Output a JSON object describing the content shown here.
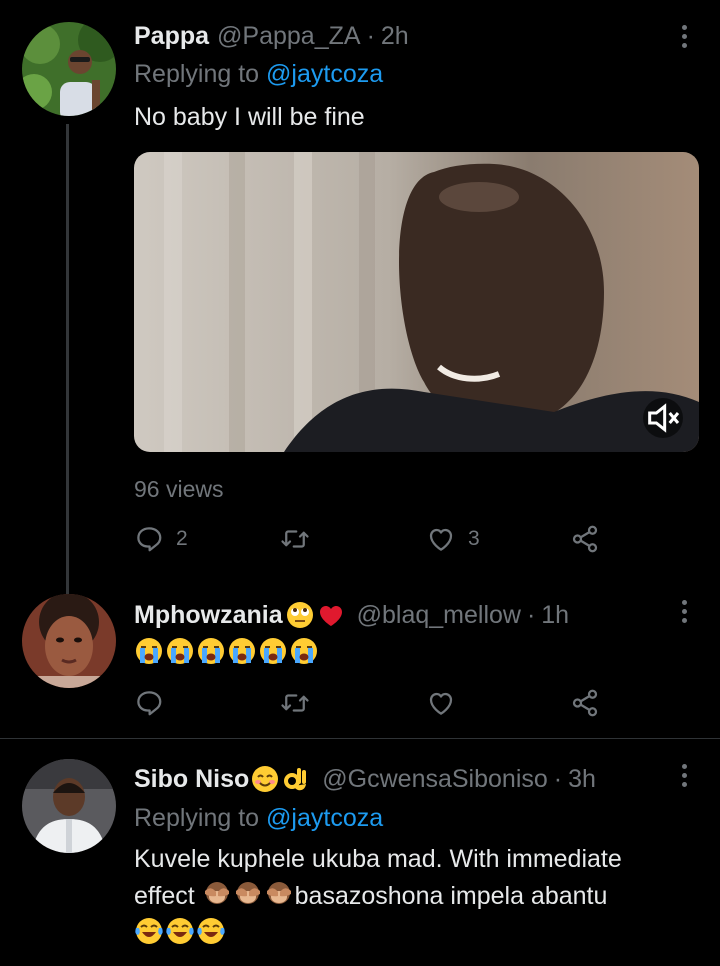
{
  "tweets": [
    {
      "name": "Pappa",
      "handle": "@Pappa_ZA",
      "separator": "·",
      "time": "2h",
      "replying_prefix": "Replying to",
      "replying_to": "@jaytcoza",
      "text": "No baby I will be fine",
      "views": "96 views",
      "reply_count": "2",
      "retweet_count": "",
      "like_count": "3"
    },
    {
      "name": "Mphowzania",
      "name_emojis": [
        "face-with-rolling-eyes-emoji",
        "red-heart-emoji"
      ],
      "handle": "@blaq_mellow",
      "separator": "·",
      "time": "1h",
      "text_emojis": [
        "loudly-crying-face-emoji",
        "loudly-crying-face-emoji",
        "loudly-crying-face-emoji",
        "loudly-crying-face-emoji",
        "loudly-crying-face-emoji",
        "loudly-crying-face-emoji"
      ],
      "reply_count": "",
      "retweet_count": "",
      "like_count": ""
    },
    {
      "name": "Sibo Niso",
      "name_emojis": [
        "smiling-face-with-smiling-eyes-emoji",
        "ok-hand-emoji"
      ],
      "handle": "@GcwensaSiboniso",
      "separator": "·",
      "time": "3h",
      "replying_prefix": "Replying to",
      "replying_to": "@jaytcoza",
      "text_line1": "Kuvele kuphele ukuba mad. With immediate",
      "text_line2_pre": "effect",
      "text_line2_emojis": [
        "see-no-evil-monkey-emoji",
        "see-no-evil-monkey-emoji",
        "see-no-evil-monkey-emoji"
      ],
      "text_line2_post": "basazoshona impela abantu",
      "text_line3_emojis": [
        "face-with-tears-of-joy-emoji",
        "face-with-tears-of-joy-emoji",
        "face-with-tears-of-joy-emoji"
      ]
    }
  ],
  "colors": {
    "background": "#000000",
    "text_primary": "#e7e9ea",
    "text_secondary": "#71767b",
    "link": "#1d9bf0",
    "divider": "#2f3336"
  },
  "icons": [
    "reply-icon",
    "retweet-icon",
    "like-icon",
    "share-icon",
    "more-icon",
    "mute-icon"
  ]
}
